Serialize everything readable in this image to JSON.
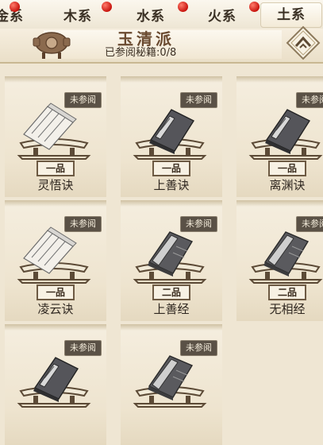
{
  "tabs": [
    {
      "label": "金系",
      "active": false
    },
    {
      "label": "木系",
      "active": false
    },
    {
      "label": "水系",
      "active": false
    },
    {
      "label": "火系",
      "active": false
    },
    {
      "label": "土系",
      "active": true
    }
  ],
  "header": {
    "sect_name": "玉清派",
    "progress_text": "已参阅秘籍:0/8"
  },
  "colors": {
    "accent_red": "#c8140e",
    "tag_bg": "#5a5146",
    "frame": "#6d5a43"
  },
  "cards": [
    {
      "status": "未参阅",
      "rank": "一品",
      "name": "灵悟诀",
      "book_style": "scroll"
    },
    {
      "status": "未参阅",
      "rank": "一品",
      "name": "上善诀",
      "book_style": "closed-book"
    },
    {
      "status": "未参阅",
      "rank": "一品",
      "name": "离渊诀",
      "book_style": "closed-book"
    },
    {
      "status": "未参阅",
      "rank": "一品",
      "name": "凌云诀",
      "book_style": "scroll"
    },
    {
      "status": "未参阅",
      "rank": "二品",
      "name": "上善经",
      "book_style": "open-book"
    },
    {
      "status": "未参阅",
      "rank": "二品",
      "name": "无相经",
      "book_style": "open-book"
    },
    {
      "status": "未参阅",
      "rank": "",
      "name": "",
      "book_style": "closed-book"
    },
    {
      "status": "未参阅",
      "rank": "",
      "name": "",
      "book_style": "open-book"
    }
  ]
}
